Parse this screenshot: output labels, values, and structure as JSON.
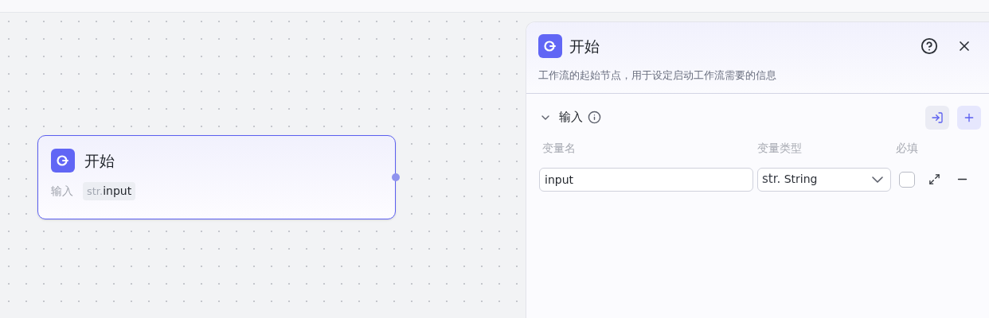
{
  "canvas": {
    "node": {
      "title": "开始",
      "input_label": "输入",
      "inputs": [
        {
          "type": "str.",
          "name": "input"
        }
      ]
    }
  },
  "panel": {
    "title": "开始",
    "description": "工作流的起始节点，用于设定启动工作流需要的信息",
    "section": {
      "title": "输入",
      "expanded": true,
      "columns": [
        "变量名",
        "变量类型",
        "必填"
      ],
      "rows": [
        {
          "name": "input",
          "type_prefix": "str.",
          "type": "String",
          "required": false
        }
      ]
    }
  }
}
